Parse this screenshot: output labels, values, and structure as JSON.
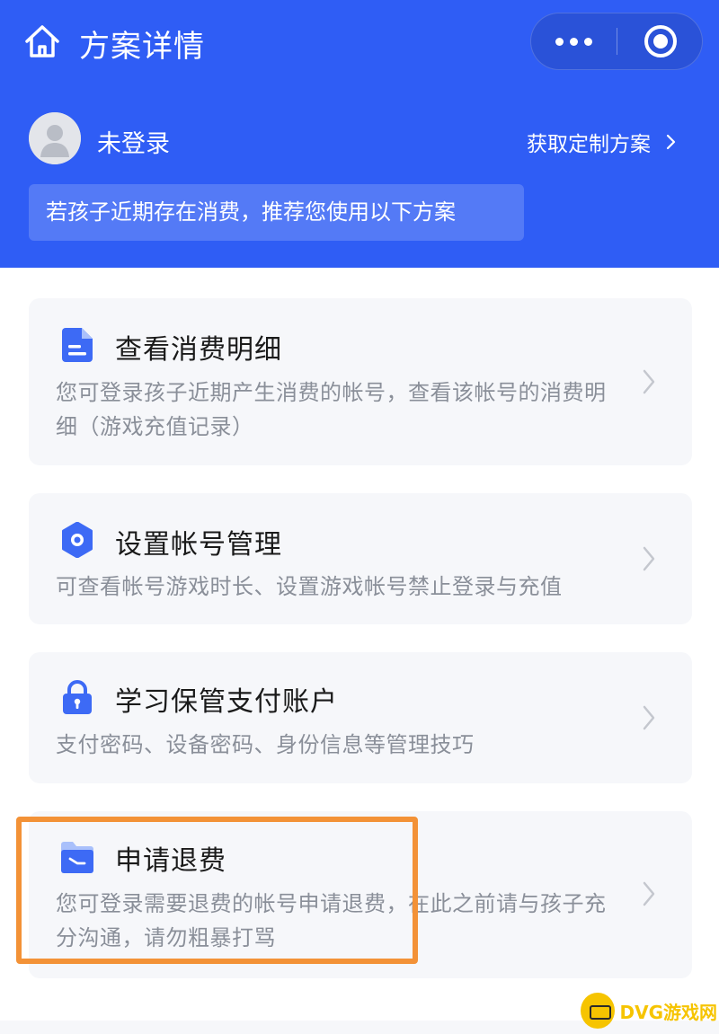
{
  "header": {
    "title": "方案详情",
    "accent_color": "#2f5df5"
  },
  "capsule": {
    "more_icon": "more-dots-icon",
    "target_icon": "target-icon"
  },
  "user": {
    "name": "未登录",
    "avatar_icon": "default-avatar-icon",
    "get_plan_label": "获取定制方案"
  },
  "notice": "若孩子近期存在消费，推荐您使用以下方案",
  "cards": [
    {
      "icon": "document-icon",
      "title": "查看消费明细",
      "desc": "您可登录孩子近期产生消费的帐号，查看该帐号的消费明细（游戏充值记录）"
    },
    {
      "icon": "gear-icon",
      "title": "设置帐号管理",
      "desc": "可查看帐号游戏时长、设置游戏帐号禁止登录与充值"
    },
    {
      "icon": "lock-icon",
      "title": "学习保管支付账户",
      "desc": "支付密码、设备密码、身份信息等管理技巧"
    },
    {
      "icon": "refund-folder-icon",
      "title": "申请退费",
      "desc": "您可登录需要退费的帐号申请退费，在此之前请与孩子充分沟通，请勿粗暴打骂"
    }
  ],
  "watermark": {
    "text": "DVG游戏网"
  }
}
